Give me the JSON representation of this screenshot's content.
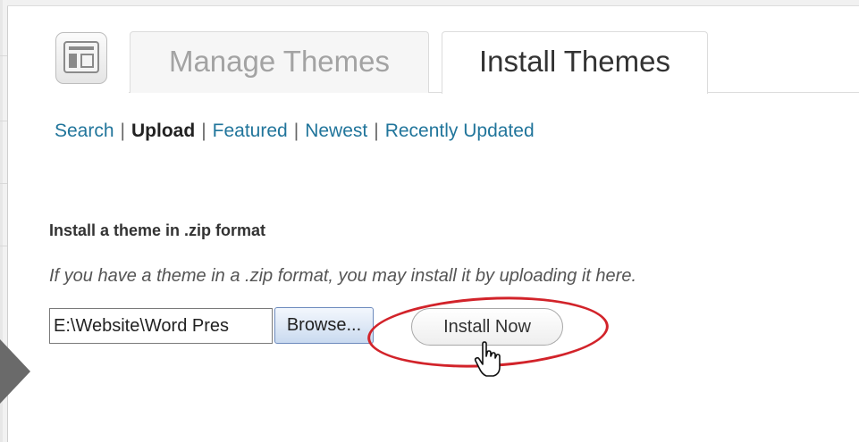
{
  "tabs": [
    {
      "label": "Manage Themes",
      "active": false
    },
    {
      "label": "Install Themes",
      "active": true
    }
  ],
  "subnav": {
    "items": [
      "Search",
      "Upload",
      "Featured",
      "Newest",
      "Recently Updated"
    ],
    "current": "Upload",
    "separator": "|"
  },
  "upload": {
    "title": "Install a theme in .zip format",
    "help": "If you have a theme in a .zip format, you may install it by uploading it here.",
    "file_value": "E:\\Website\\Word Pres",
    "browse_label": "Browse...",
    "install_label": "Install Now"
  },
  "icons": {
    "theme": "appearance-icon",
    "cursor": "hand-pointer-icon",
    "collapse": "collapse-arrow-icon"
  },
  "colors": {
    "link": "#21759b",
    "highlight_ring": "#d2232a",
    "collapse_arrow": "#6a6a6a"
  }
}
